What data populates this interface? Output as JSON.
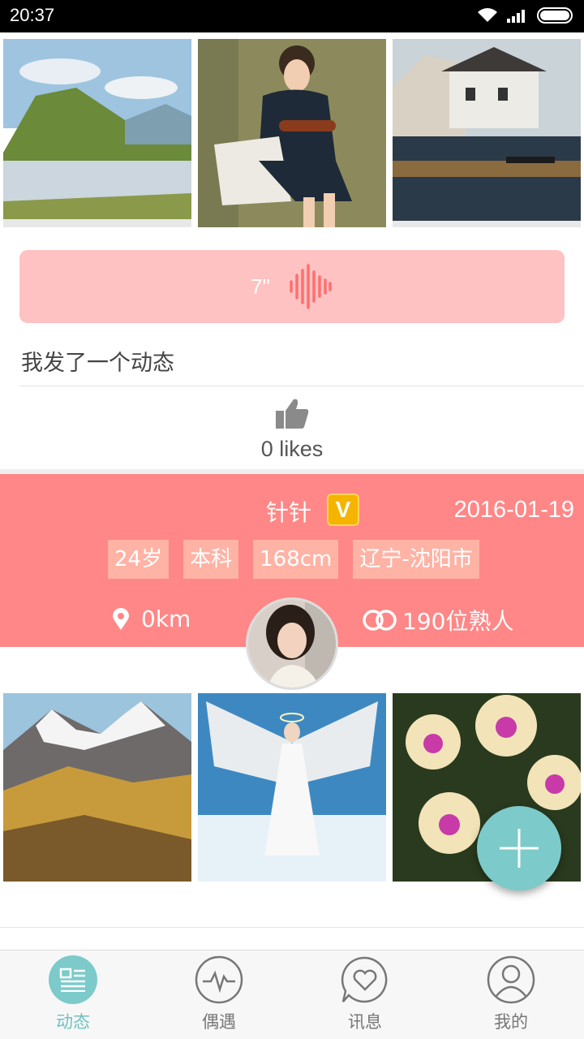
{
  "status_bar": {
    "time": "20:37"
  },
  "feed": {
    "post1": {
      "photos": [
        "landscape-painting",
        "violinist-painting",
        "water-town-painting"
      ],
      "voice_duration": "7\"",
      "text": "我发了一个动态",
      "likes": "0 likes"
    },
    "post2": {
      "name": "针针",
      "verified_badge": "V",
      "date": "2016-01-19",
      "tags": [
        "24岁",
        "本科",
        "168cm",
        "辽宁-沈阳市"
      ],
      "distance": "0km",
      "acquaintances": "190位熟人",
      "photos": [
        "mountain-photo",
        "angel-photo",
        "orchid-photo"
      ]
    }
  },
  "colors": {
    "accent": "#7ccaca",
    "profile_bg": "#ff8787",
    "voice_bg": "#ffc2c2",
    "badge": "#f5b400"
  },
  "tabbar": {
    "tabs": [
      {
        "label": "动态",
        "icon": "news-icon"
      },
      {
        "label": "偶遇",
        "icon": "pulse-icon"
      },
      {
        "label": "讯息",
        "icon": "heart-chat-icon"
      },
      {
        "label": "我的",
        "icon": "user-icon"
      }
    ]
  }
}
